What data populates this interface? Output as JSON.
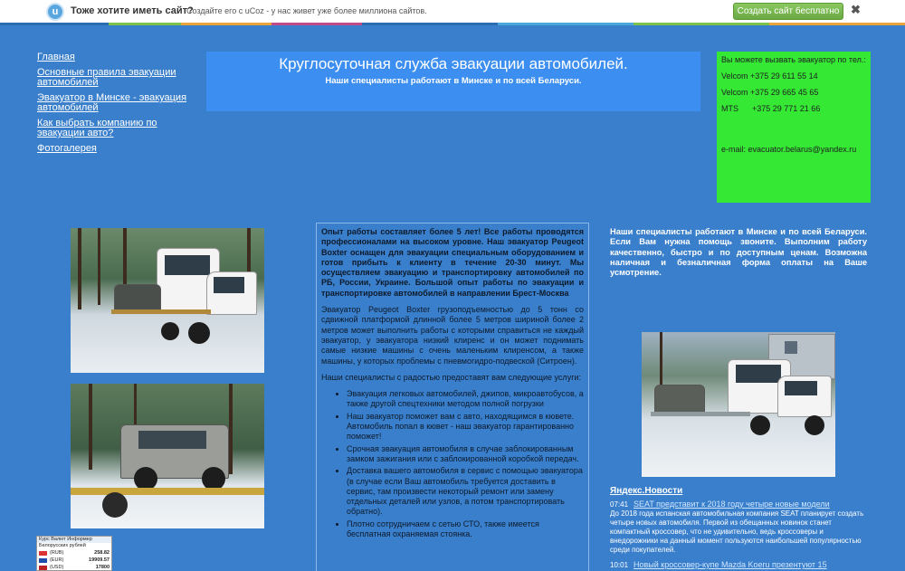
{
  "topbar": {
    "logo_letter": "u",
    "title": "Тоже хотите иметь сайт?",
    "subtitle": "Создайте его с uCoz -  у нас живет уже более миллиона сайтов.",
    "create_button": "Создать сайт бесплатно",
    "close_label": "✖"
  },
  "nav": {
    "items": [
      "Главная",
      "Основные правила эвакуации автомобилей",
      "Эвакуатор в Минске - эвакуация автомобилей",
      "Как выбрать компанию по эвакуации авто?",
      "Фотогалерея"
    ]
  },
  "header": {
    "title": "Круглосуточная служба эвакуации автомобилей.",
    "subtitle": "Наши специалисты работают в Минске и по всей Беларуси."
  },
  "contact": {
    "intro": "Вы можете вызвать эвакуатор по тел.:",
    "phones": [
      "Velcom +375 29 611 55 14",
      "Velcom +375 29 665 45 65",
      "MTS      +375 29 771 21 66"
    ],
    "email": "e-mail: evacuator.belarus@yandex.ru"
  },
  "center": {
    "lead": "Опыт работы составляет более 5 лет! Все работы проводятся профессионалами на высоком уровне. Наш эвакуатор Peugeot Boxter оснащен для эвакуации специальным оборудованием и готов прибыть к клиенту в течение 20-30 минут. Мы осуществляем эвакуацию и транспортировку автомобилей по РБ, России, Украине. Большой опыт работы по эвакуации и транспортировке автомобилей в направлении Брест-Москва",
    "para": "Эвакуатор Peugeot Boxter грузоподъемностью до 5 тонн со сдвижной платформой длинной более 5 метров шириной более 2 метров может выполнить работы с которыми справиться не каждый эвакуатор, у эвакуатора низкий клиренс и он может поднимать самые низкие машины с очень маленьким клиренсом, а также машины, у которых проблемы с пневмогидро-подвеской (Ситроен).",
    "services_intro": "Наши специалисты с радостью предоставят вам следующие услуги:",
    "services": [
      "Эвакуация легковых автомобилей, джипов, микроавтобусов, а также другой спецтехники методом полной погрузки",
      "Наш эвакуатор поможет вам с авто, находящимся в кювете. Автомобиль попал в кювет - наш эвакуатор гарантированно поможет!",
      "Срочная эвакуация автомобиля в случае заблокированным замком зажигания или с заблокированной коробкой передач.",
      "Доставка вашего автомобиля в сервис с помощью эвакуатора (в случае если Ваш автомобиль требуется доставить в сервис, там произвести некоторый ремонт или замену отдельных деталей или узлов, а потом транспортировать обратно).",
      "Плотно сотрудничаем с сетью СТО, также имеется бесплатная охраняемая стоянка."
    ]
  },
  "right_text": "Наши специалисты работают в Минске и по всей Беларуси. Если Вам нужна помощь звоните. Выполним работу качественно, быстро и по доступным ценам. Возможна наличная и безналичная форма оплаты на Ваше усмотрение.",
  "news": {
    "heading": "Яндекс.Новости",
    "items": [
      {
        "time": "07:41",
        "title": "SEAT представит к 2018 году четыре новые модели",
        "body": "До 2018 года испанская автомобильная компания SEAT планирует создать четыре новых автомобиля. Первой из обещанных новинок станет компактный кроссовер, что не удивительно, ведь кроссоверы и внедорожники на данный момент пользуются наибольшей популярностью среди покупателей."
      },
      {
        "time": "10:01",
        "title": "Новый кроссовер-купе Mazda Koeru презентуют 15",
        "body": ""
      }
    ]
  },
  "currency": {
    "title": "Курс Валют Информер",
    "subtitle": "Белорусских рублей",
    "rows": [
      {
        "code": "(RUB)",
        "value": "258.82",
        "flag_color": "#d33"
      },
      {
        "code": "(EUR)",
        "value": "19909.57",
        "flag_color": "#1f4fa8"
      },
      {
        "code": "(USD)",
        "value": "17800",
        "flag_color": "#b22"
      }
    ]
  },
  "colors": {
    "background": "#3a7fcb",
    "header_bg": "#3c8ef0",
    "contact_bg": "#34e834",
    "button_green": "#6aa844"
  }
}
